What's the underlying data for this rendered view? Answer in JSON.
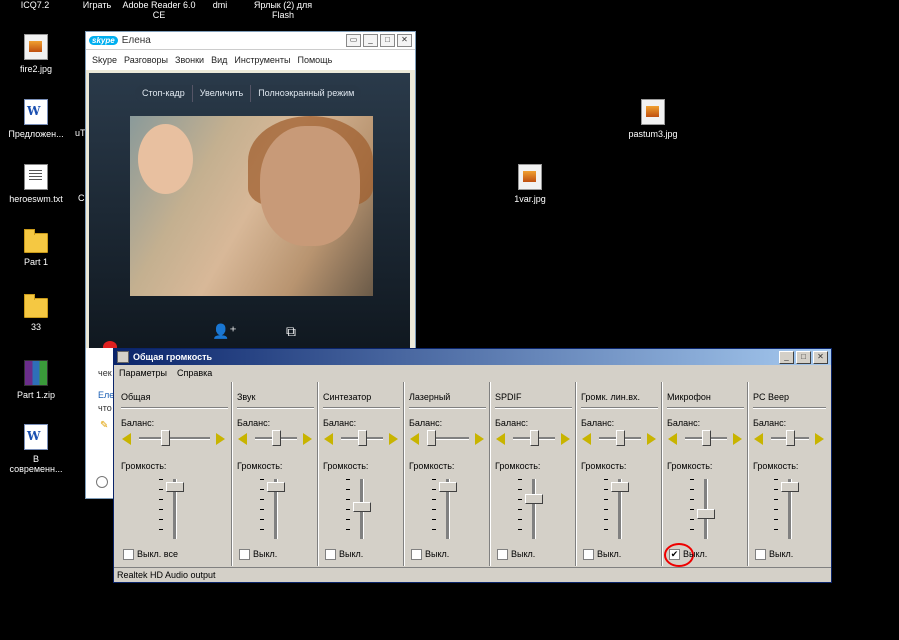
{
  "desktop": {
    "top_labels": [
      "ICQ7.2",
      "Играть",
      "Adobe Reader 6.0 CE",
      "dmi",
      "Ярлык (2) для Flash"
    ],
    "icons": [
      {
        "label": "fire2.jpg",
        "icon": "image-file-icon"
      },
      {
        "label": "Предложен...",
        "icon": "word-document-icon"
      },
      {
        "label": "heroeswm.txt",
        "icon": "text-file-icon"
      },
      {
        "label": "Part 1",
        "icon": "folder-icon"
      },
      {
        "label": "33",
        "icon": "folder-icon"
      },
      {
        "label": "Part 1.zip",
        "icon": "archive-icon"
      },
      {
        "label": "В современн...",
        "icon": "word-document-icon"
      },
      {
        "label": "pastum3.jpg",
        "icon": "image-file-icon"
      },
      {
        "label": "1var.jpg",
        "icon": "image-file-icon"
      }
    ],
    "partial_labels": [
      "uT",
      "Cr"
    ]
  },
  "skype": {
    "logo": "skype",
    "title": "Елена",
    "menu": [
      "Skype",
      "Разговоры",
      "Звонки",
      "Вид",
      "Инструменты",
      "Помощь"
    ],
    "video_controls": [
      "Стоп-кадр",
      "Увеличить",
      "Полноэкранный режим"
    ],
    "side_texts": [
      "чек",
      "Еле",
      "что"
    ]
  },
  "mixer": {
    "title": "Общая громкость",
    "menu": [
      "Параметры",
      "Справка"
    ],
    "balance_label": "Баланс:",
    "volume_label": "Громкость:",
    "status": "Realtek HD Audio output",
    "channels": [
      {
        "name": "Общая",
        "mute_label": "Выкл. все",
        "muted": false,
        "balance": 0.35,
        "volume": 0.95
      },
      {
        "name": "Звук",
        "mute_label": "Выкл.",
        "muted": false,
        "balance": 0.5,
        "volume": 0.95
      },
      {
        "name": "Синтезатор",
        "mute_label": "Выкл.",
        "muted": false,
        "balance": 0.5,
        "volume": 0.55
      },
      {
        "name": "Лазерный",
        "mute_label": "Выкл.",
        "muted": false,
        "balance": 0.0,
        "volume": 0.95
      },
      {
        "name": "SPDIF",
        "mute_label": "Выкл.",
        "muted": false,
        "balance": 0.5,
        "volume": 0.7
      },
      {
        "name": "Громк. лин.вх.",
        "mute_label": "Выкл.",
        "muted": false,
        "balance": 0.5,
        "volume": 0.95
      },
      {
        "name": "Микрофон",
        "mute_label": "Выкл.",
        "muted": true,
        "balance": 0.5,
        "volume": 0.4
      },
      {
        "name": "PC Beep",
        "mute_label": "Выкл.",
        "muted": false,
        "balance": 0.5,
        "volume": 0.95
      }
    ]
  }
}
